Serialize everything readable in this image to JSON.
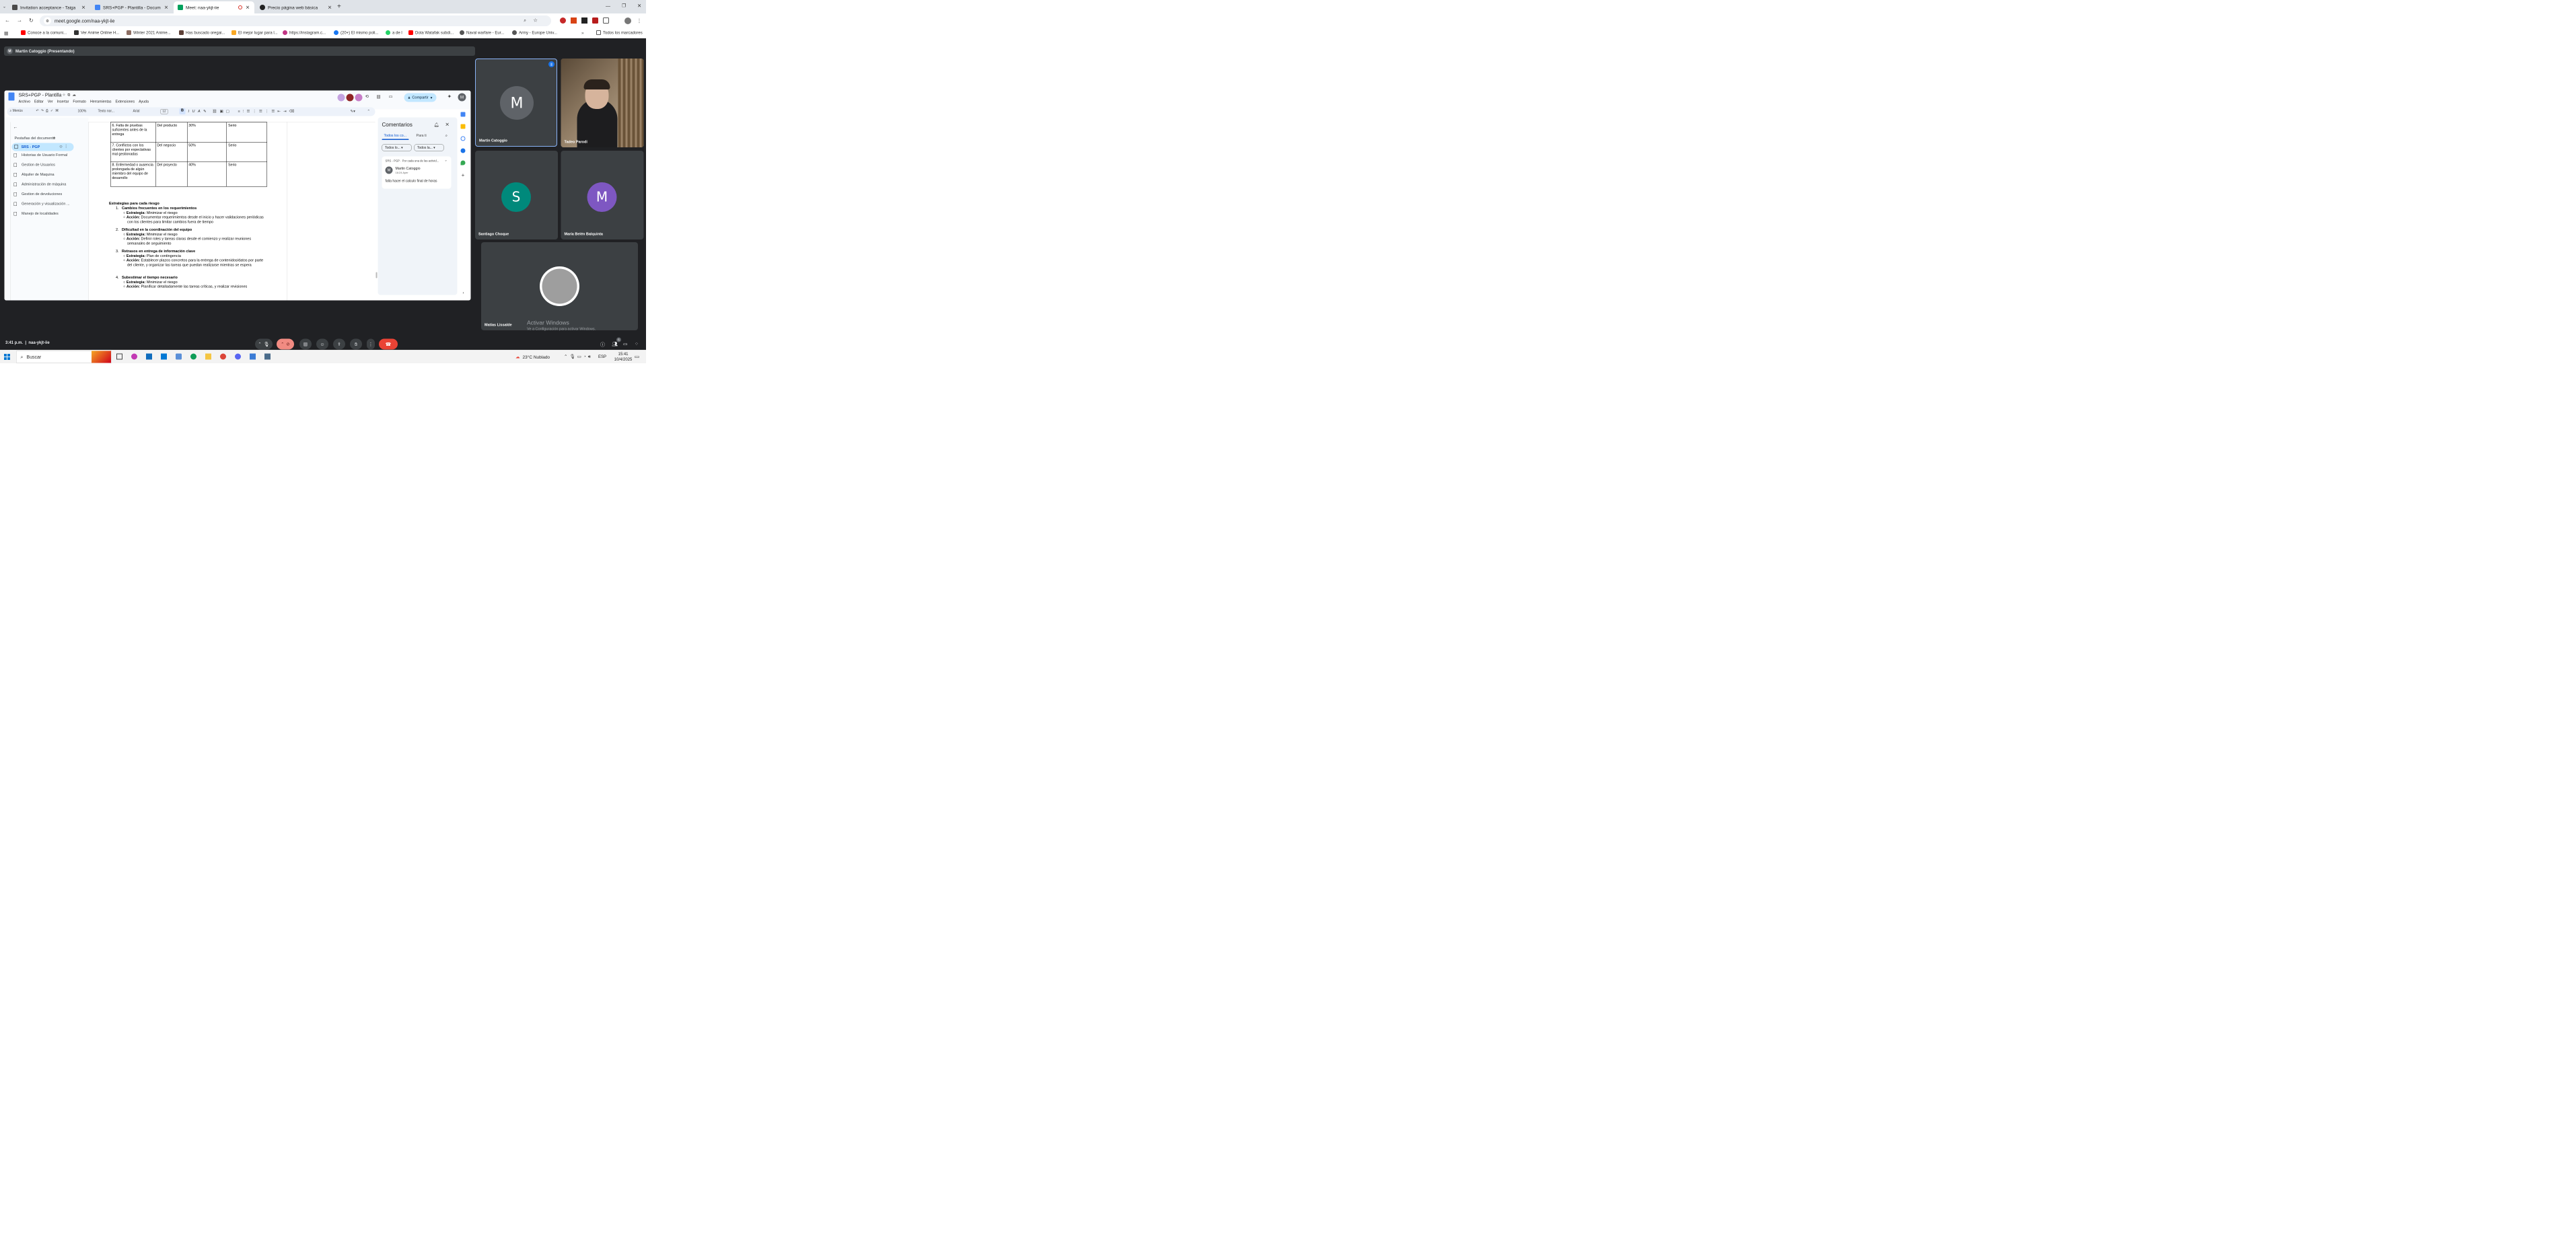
{
  "browser": {
    "tabs": [
      {
        "title": "Invitation acceptance - Taiga",
        "color": "#4a4a4a"
      },
      {
        "title": "SRS+PGP - Plantilla - Docume",
        "color": "#4285f4"
      },
      {
        "title": "Meet: naa-ykjt-iie",
        "color": "#00a15d"
      },
      {
        "title": "Precio página web básica",
        "color": "#222222"
      }
    ],
    "url": "meet.google.com/naa-ykjt-iie",
    "bookmarks": [
      "Conoce a la comuni...",
      "Ver Anime Online H...",
      "Winter 2021 Anime...",
      "Has buscado oregai...",
      "El mejor lugar para l...",
      "https://instagram.c...",
      "(20+) El mismo poli...",
      "a de l",
      "Dota Watafak subdi...",
      "Naval warfare - Eur...",
      "Army - Europe Univ...",
      "Todos los marcadores"
    ]
  },
  "meet": {
    "presenter": "Martin Catoggio (Presentando)",
    "presenter_initial": "M",
    "time_code": "3:41 p.m.  |  naa-ykjt-iie",
    "participants": [
      {
        "name": "Martin Catoggio",
        "initial": "M",
        "color": "#5f6368"
      },
      {
        "name": "Tadeo Parodi",
        "initial": "",
        "color": "#6b5a48"
      },
      {
        "name": "Santiago Choque",
        "initial": "S",
        "color": "#00897b"
      },
      {
        "name": "María Belén Balquinta",
        "initial": "M",
        "color": "#7e57c2"
      },
      {
        "name": "Matías Lissalde",
        "initial": "",
        "color": "#9e9e9e"
      }
    ],
    "watermark": {
      "title": "Activar Windows",
      "subtitle": "Ve a Configuración para activar Windows."
    },
    "people_count": "6"
  },
  "doc": {
    "title": "SRS+PGP - Plantilla",
    "menu": [
      "Archivo",
      "Editar",
      "Ver",
      "Insertar",
      "Formato",
      "Herramientas",
      "Extensiones",
      "Ayuda"
    ],
    "toolbar": {
      "search": "Menús",
      "zoom": "100%",
      "style": "Texto nor...",
      "font": "Arial",
      "size": "12"
    },
    "share": "Compartir",
    "outline_header": "Pestañas del documento",
    "outline_active": "SRS - PGP",
    "outline": [
      "Historias de Usuario Formal",
      "Gestion de Usuarios",
      "Alquiler de Maquina",
      "Administración de máquina",
      "Gestion de devoluciones",
      "Generación y visualización ...",
      "Manejo de localidades"
    ],
    "rows": [
      {
        "risk": "6. Falta de pruebas suficientes antes de la entrega",
        "type": "Del producto",
        "prob": "30%",
        "impact": "Serio"
      },
      {
        "risk": "7. Conflictos con los clientes por expectativas mal gestionadas",
        "type": "Del negocio",
        "prob": "50%",
        "impact": "Serio"
      },
      {
        "risk": "8. Enfermedad o ausencia prolongada de algún miembro del equipo de desarrollo",
        "type": "Del proyecto",
        "prob": "40%",
        "impact": "Serio"
      }
    ],
    "strategies_title": "Estrategias para cada riesgo",
    "strategies": [
      {
        "n": "1.",
        "title": "Cambios frecuentes en los requerimientos",
        "estrategia": "Minimizar el riesgo",
        "accion": "Documentar requerimientos desde el inicio y hacer validaciones periódicas con los clientes para limitar cambios fuera de tiempo"
      },
      {
        "n": "2.",
        "title": "Dificultad en la coordinación del equipo",
        "estrategia": "Minimizar el riesgo",
        "accion": "Definir roles y tareas claras desde el comienzo y realizar reuniones semanales de seguimiento"
      },
      {
        "n": "3.",
        "title": "Retrasos en entrega de información clave",
        "estrategia": "Plan de contingencia",
        "accion": "Establecer plazos concretos para la entrega de contenidos/datos por parte del cliente, y organizar las tareas que puedan realizarse mientras se espera"
      },
      {
        "n": "4.",
        "title": "Subestimar el tiempo necesario",
        "estrategia": "Minimizar el riesgo",
        "accion": "Planificar detalladamente las tareas críticas, y realizar revisiones"
      }
    ],
    "labels": {
      "estrategia": "Estrategia:",
      "accion": "Acción:"
    },
    "comments": {
      "title": "Comentarios",
      "tab_all": "Todos los co...",
      "tab_you": "Para ti",
      "filter1": "Todos lo...",
      "filter2": "Todos la...",
      "thread_title": "SRS - PGP · Por cada una de las activid...",
      "author": "Martin Catoggio",
      "time": "16:24 Ayer",
      "body": "falta hacer el calculo final de horas"
    }
  },
  "taskbar": {
    "search": "Buscar",
    "weather": "23°C  Nublado",
    "lang": "ESP",
    "time": "15:41",
    "date": "10/4/2025"
  }
}
